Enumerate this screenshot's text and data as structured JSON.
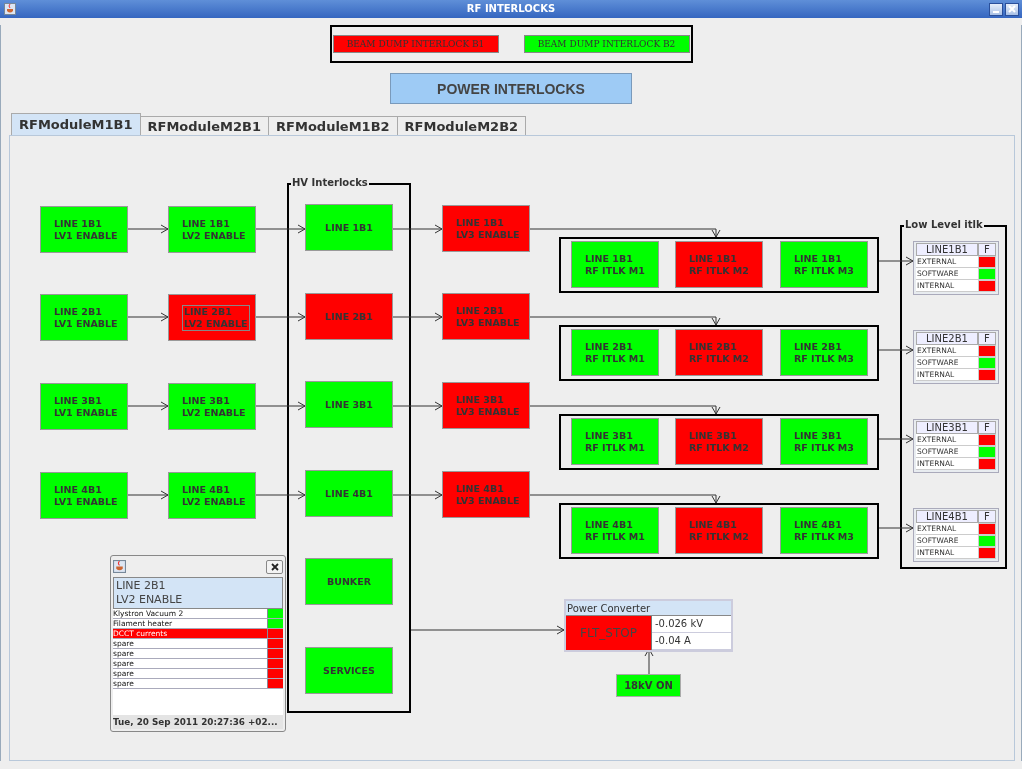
{
  "window": {
    "title": "RF INTERLOCKS"
  },
  "beam_dump": [
    {
      "label": "BEAM DUMP INTERLOCK B1",
      "ok": false
    },
    {
      "label": "BEAM DUMP INTERLOCK B2",
      "ok": true
    }
  ],
  "power_interlocks_button": "POWER INTERLOCKS",
  "tabs": [
    {
      "label": "RFModuleM1B1",
      "selected": true
    },
    {
      "label": "RFModuleM2B1",
      "selected": false
    },
    {
      "label": "RFModuleM1B2",
      "selected": false
    },
    {
      "label": "RFModuleM2B2",
      "selected": false
    }
  ],
  "lv1": [
    {
      "lines": [
        "LINE 1B1",
        "LV1 ENABLE"
      ],
      "ok": true
    },
    {
      "lines": [
        "LINE 2B1",
        "LV1 ENABLE"
      ],
      "ok": true
    },
    {
      "lines": [
        "LINE 3B1",
        "LV1 ENABLE"
      ],
      "ok": true
    },
    {
      "lines": [
        "LINE 4B1",
        "LV1 ENABLE"
      ],
      "ok": true
    }
  ],
  "lv2": [
    {
      "lines": [
        "LINE 1B1",
        "LV2 ENABLE"
      ],
      "ok": true,
      "focused": false
    },
    {
      "lines": [
        "LINE 2B1",
        "LV2 ENABLE"
      ],
      "ok": false,
      "focused": true
    },
    {
      "lines": [
        "LINE 3B1",
        "LV2 ENABLE"
      ],
      "ok": true,
      "focused": false
    },
    {
      "lines": [
        "LINE 4B1",
        "LV2 ENABLE"
      ],
      "ok": true,
      "focused": false
    }
  ],
  "hv_interlocks": {
    "title": "HV Interlocks",
    "items": [
      {
        "label": "LINE 1B1",
        "ok": true
      },
      {
        "label": "LINE 2B1",
        "ok": false
      },
      {
        "label": "LINE 3B1",
        "ok": true
      },
      {
        "label": "LINE 4B1",
        "ok": true
      },
      {
        "label": "BUNKER",
        "ok": true
      },
      {
        "label": "SERVICES",
        "ok": true
      }
    ]
  },
  "lv3": [
    {
      "lines": [
        "LINE 1B1",
        "LV3 ENABLE"
      ],
      "ok": false
    },
    {
      "lines": [
        "LINE 2B1",
        "LV3 ENABLE"
      ],
      "ok": false
    },
    {
      "lines": [
        "LINE 3B1",
        "LV3 ENABLE"
      ],
      "ok": false
    },
    {
      "lines": [
        "LINE 4B1",
        "LV3 ENABLE"
      ],
      "ok": false
    }
  ],
  "rf_groups": [
    {
      "items": [
        {
          "lines": [
            "LINE 1B1",
            "RF ITLK M1"
          ],
          "ok": true
        },
        {
          "lines": [
            "LINE 1B1",
            "RF ITLK M2"
          ],
          "ok": false
        },
        {
          "lines": [
            "LINE 1B1",
            "RF ITLK M3"
          ],
          "ok": true
        }
      ]
    },
    {
      "items": [
        {
          "lines": [
            "LINE 2B1",
            "RF ITLK M1"
          ],
          "ok": true
        },
        {
          "lines": [
            "LINE 2B1",
            "RF ITLK M2"
          ],
          "ok": false
        },
        {
          "lines": [
            "LINE 2B1",
            "RF ITLK M3"
          ],
          "ok": true
        }
      ]
    },
    {
      "items": [
        {
          "lines": [
            "LINE 3B1",
            "RF ITLK M1"
          ],
          "ok": true
        },
        {
          "lines": [
            "LINE 3B1",
            "RF ITLK M2"
          ],
          "ok": false
        },
        {
          "lines": [
            "LINE 3B1",
            "RF ITLK M3"
          ],
          "ok": true
        }
      ]
    },
    {
      "items": [
        {
          "lines": [
            "LINE 4B1",
            "RF ITLK M1"
          ],
          "ok": true
        },
        {
          "lines": [
            "LINE 4B1",
            "RF ITLK M2"
          ],
          "ok": false
        },
        {
          "lines": [
            "LINE 4B1",
            "RF ITLK M3"
          ],
          "ok": true
        }
      ]
    }
  ],
  "low_level": {
    "title": "Low Level itlk",
    "tables": [
      {
        "header": "LINE1B1",
        "flag_header": "F",
        "rows": [
          {
            "label": "EXTERNAL",
            "ok": false
          },
          {
            "label": "SOFTWARE",
            "ok": true
          },
          {
            "label": "INTERNAL",
            "ok": false
          }
        ]
      },
      {
        "header": "LINE2B1",
        "flag_header": "F",
        "rows": [
          {
            "label": "EXTERNAL",
            "ok": false
          },
          {
            "label": "SOFTWARE",
            "ok": true
          },
          {
            "label": "INTERNAL",
            "ok": false
          }
        ]
      },
      {
        "header": "LINE3B1",
        "flag_header": "F",
        "rows": [
          {
            "label": "EXTERNAL",
            "ok": false
          },
          {
            "label": "SOFTWARE",
            "ok": true
          },
          {
            "label": "INTERNAL",
            "ok": false
          }
        ]
      },
      {
        "header": "LINE4B1",
        "flag_header": "F",
        "rows": [
          {
            "label": "EXTERNAL",
            "ok": false
          },
          {
            "label": "SOFTWARE",
            "ok": true
          },
          {
            "label": "INTERNAL",
            "ok": false
          }
        ]
      }
    ]
  },
  "power_converter": {
    "title": "Power Converter",
    "state": "FLT_STOP",
    "ok": false,
    "readings": [
      "-0.026 kV",
      "-0.04 A"
    ]
  },
  "supply": {
    "label": "18kV ON",
    "ok": true
  },
  "popup": {
    "title_lines": [
      "LINE 2B1",
      "LV2 ENABLE"
    ],
    "rows": [
      {
        "label": "Klystron Vacuum 2",
        "ok": true,
        "alarm": false
      },
      {
        "label": "Filament heater",
        "ok": true,
        "alarm": false
      },
      {
        "label": "DCCT currents",
        "ok": false,
        "alarm": true
      },
      {
        "label": "spare",
        "ok": false,
        "alarm": false
      },
      {
        "label": "spare",
        "ok": false,
        "alarm": false
      },
      {
        "label": "spare",
        "ok": false,
        "alarm": false
      },
      {
        "label": "spare",
        "ok": false,
        "alarm": false
      },
      {
        "label": "spare",
        "ok": false,
        "alarm": false
      }
    ],
    "footer": "Tue, 20 Sep 2011 20:27:36 +02..."
  }
}
